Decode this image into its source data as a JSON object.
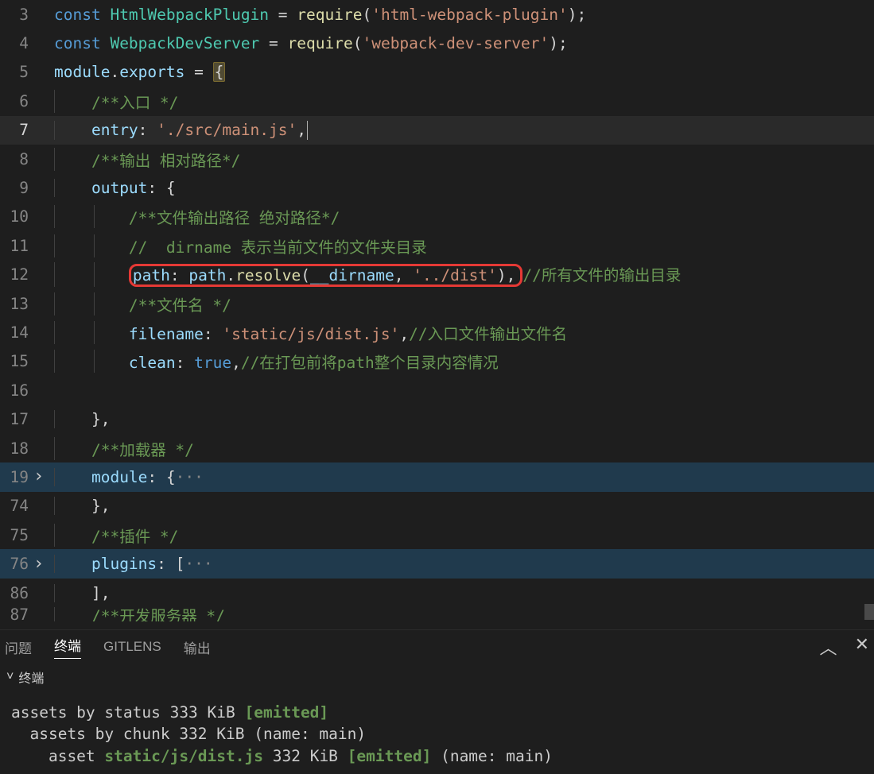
{
  "gutter": {
    "l3": "3",
    "l4": "4",
    "l5": "5",
    "l6": "6",
    "l7": "7",
    "l8": "8",
    "l9": "9",
    "l10": "10",
    "l11": "11",
    "l12": "12",
    "l13": "13",
    "l14": "14",
    "l15": "15",
    "l16": "16",
    "l17": "17",
    "l18": "18",
    "l19": "19",
    "l74": "74",
    "l75": "75",
    "l76": "76",
    "l86": "86",
    "l87": "87"
  },
  "tokens": {
    "const": "const",
    "HtmlWebpackPlugin": "HtmlWebpackPlugin",
    "WebpackDevServer": "WebpackDevServer",
    "eq": " = ",
    "require": "require",
    "lp": "(",
    "rp": ")",
    "sc": ";",
    "comma": ",",
    "htmlPlugStr": "'html-webpack-plugin'",
    "devServerStr": "'webpack-dev-server'",
    "module": "module",
    "exports": "exports",
    "dot": ".",
    "lbrace": "{",
    "rbrace": "}",
    "cm_entry": "/**入口 */",
    "entry": "entry",
    "colon": ": ",
    "entryStr": "'./src/main.js'",
    "cm_output": "/**输出 相对路径*/",
    "output": "output",
    "cm_filepath": "/**文件输出路径 绝对路径*/",
    "cm_dirname": "//  dirname 表示当前文件的文件夹目录",
    "path": "path",
    "resolve": "resolve",
    "__dirname": "__dirname",
    "distStr": "'../dist'",
    "cm_pathTail": "//所有文件的输出目录",
    "cm_filename": "/**文件名 */",
    "filename": "filename",
    "filenameStr": "'static/js/dist.js'",
    "cm_filenameTail": "//入口文件输出文件名",
    "clean": "clean",
    "true": "true",
    "cm_cleanTail": "//在打包前将path整个目录内容情况",
    "cm_loader": "/**加载器 */",
    "moduleProp": "module",
    "ellipsis": "···",
    "cm_plugin": "/**插件 */",
    "plugins": "plugins",
    "lbracket": "[",
    "rbracket": "]",
    "cm_devserver": "/**开发服务器 */"
  },
  "panel": {
    "tabs": {
      "problems": "问题",
      "terminal": "终端",
      "gitlens": "GITLENS",
      "output": "输出"
    },
    "terminalHeader": "终端",
    "out1": "assets by status 333 KiB ",
    "emitted1": "[emitted]",
    "out2": "  assets by chunk 332 KiB (name: main)",
    "out3a": "    asset ",
    "out3b": "static/js/dist.js",
    "out3c": " 332 KiB ",
    "emitted2": "[emitted]",
    "out3d": " (name: main)"
  }
}
